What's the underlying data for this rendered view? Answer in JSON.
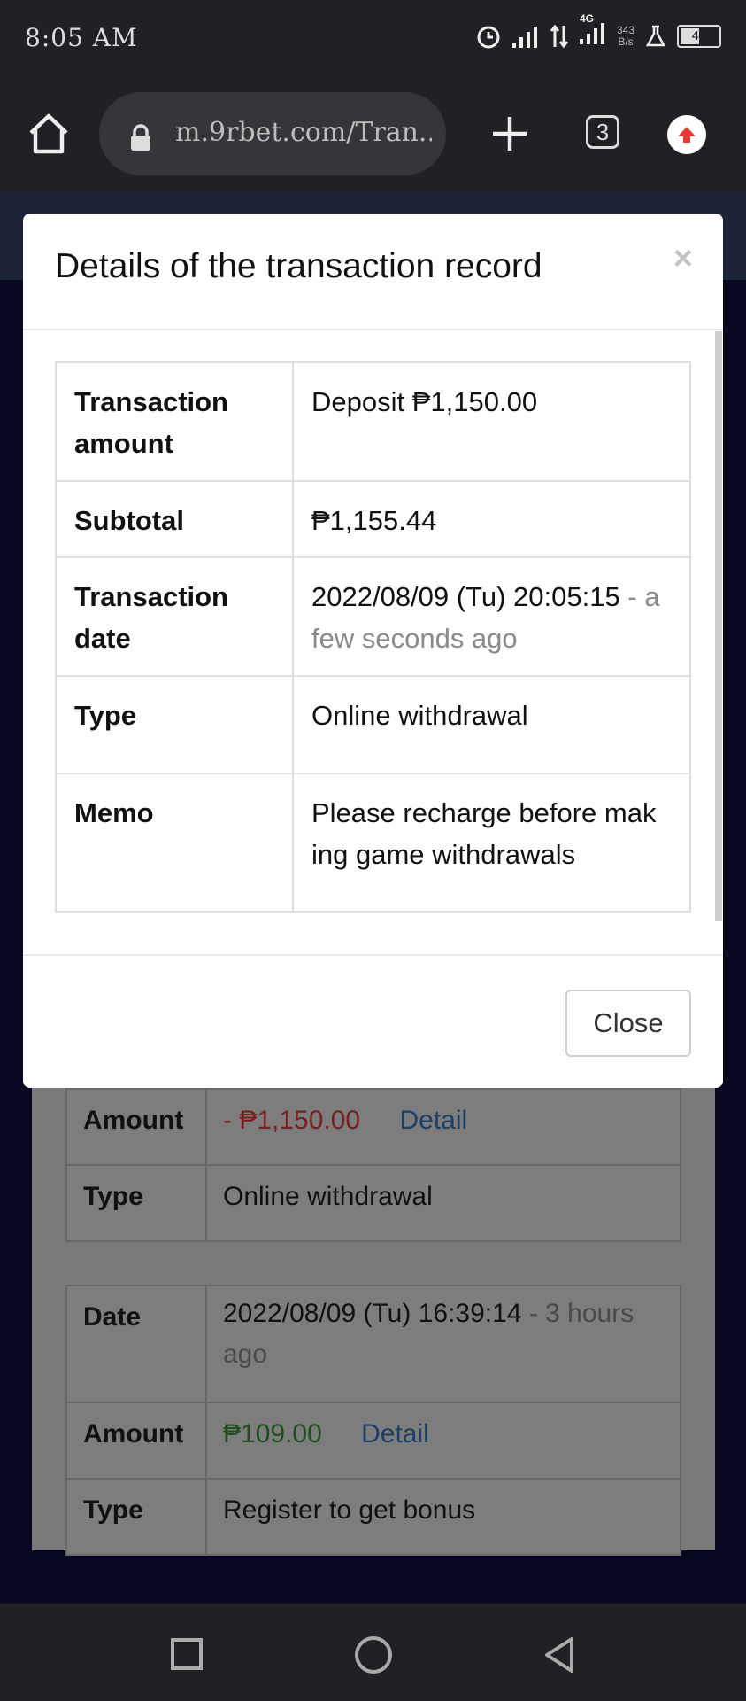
{
  "status_bar": {
    "time": "8:05 AM",
    "net_speed_top": "343",
    "net_speed_bottom": "B/s",
    "network": "4G",
    "battery": "49"
  },
  "browser": {
    "url": "m.9rbet.com/Tran...",
    "tab_count": "3"
  },
  "modal": {
    "title": "Details of the transaction record",
    "close_symbol": "×",
    "rows": [
      {
        "label": "Transaction amount",
        "value": "Deposit ₱1,150.00"
      },
      {
        "label": "Subtotal",
        "value": "₱1,155.44"
      },
      {
        "label": "Transaction date",
        "value": "2022/08/09 (Tu) 20:05:15",
        "suffix": " - a few seconds ago"
      },
      {
        "label": "Type",
        "value": "Online withdrawal"
      },
      {
        "label": "Memo",
        "value": "Please recharge before mak ing game withdrawals"
      }
    ],
    "close_button": "Close"
  },
  "background": {
    "record1": {
      "amount_label": "Amount",
      "amount_value": "- ₱1,150.00",
      "detail_link": "Detail",
      "type_label": "Type",
      "type_value": "Online withdrawal"
    },
    "record2": {
      "date_label": "Date",
      "date_value": "2022/08/09 (Tu) 16:39:14",
      "date_suffix": " - 3 hours ago",
      "amount_label": "Amount",
      "amount_value": "₱109.00",
      "detail_link": "Detail",
      "type_label": "Type",
      "type_value": "Register to get bonus"
    }
  },
  "colors": {
    "deposit_green": "#3c7d3a",
    "withdraw_red": "#c62828",
    "link_blue": "#2a6aaf"
  }
}
